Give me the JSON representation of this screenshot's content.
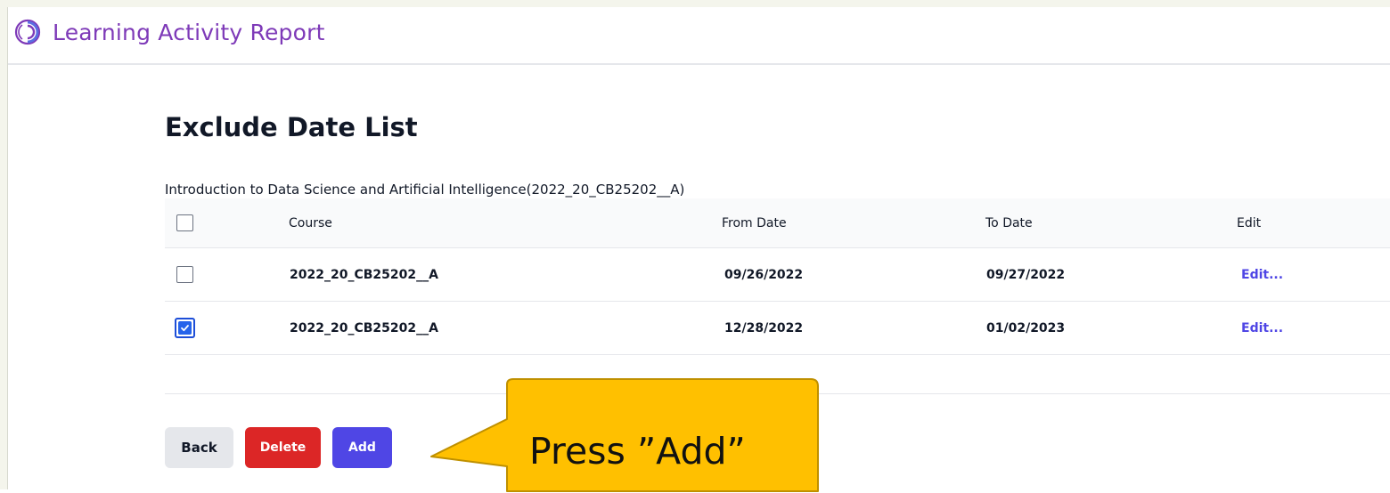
{
  "app": {
    "title": "Learning Activity Report",
    "logo_icon": "spiral-logo-icon"
  },
  "page": {
    "heading": "Exclude Date List",
    "course_caption": "Introduction to Data Science and Artificial Intelligence(2022_20_CB25202__A)"
  },
  "table": {
    "columns": {
      "select_all": false,
      "course": "Course",
      "from_date": "From Date",
      "to_date": "To Date",
      "edit": "Edit"
    },
    "rows": [
      {
        "checked": false,
        "course": "2022_20_CB25202__A",
        "from_date": "09/26/2022",
        "to_date": "09/27/2022",
        "edit": "Edit..."
      },
      {
        "checked": true,
        "course": "2022_20_CB25202__A",
        "from_date": "12/28/2022",
        "to_date": "01/02/2023",
        "edit": "Edit..."
      }
    ]
  },
  "buttons": {
    "back": "Back",
    "delete": "Delete",
    "add": "Add"
  },
  "callout": {
    "text": "Press ”Add”"
  },
  "colors": {
    "brand": "#7e3ab8",
    "primary": "#4f46e5",
    "danger": "#dc2626",
    "callout_fill": "#ffc000",
    "callout_border": "#bf9000"
  }
}
